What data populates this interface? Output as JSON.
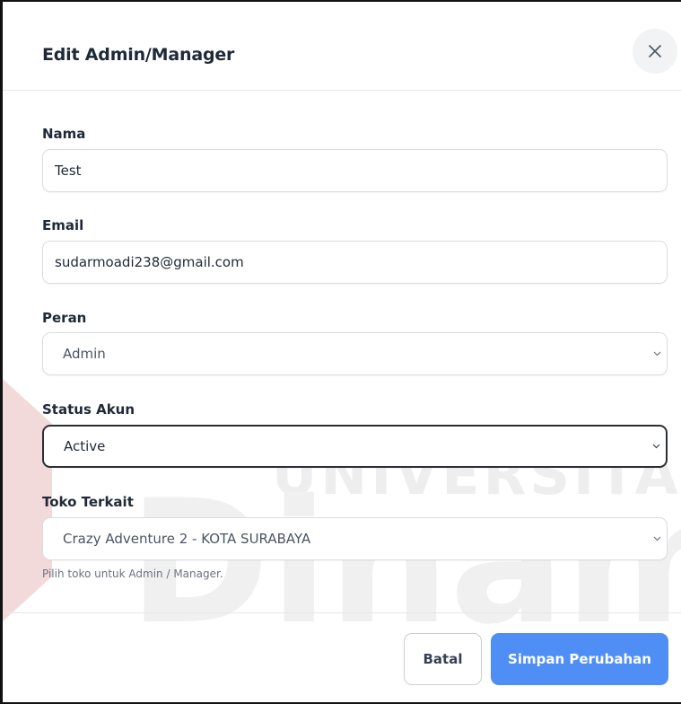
{
  "modal": {
    "title": "Edit Admin/Manager",
    "close_icon": "close-icon"
  },
  "fields": {
    "nama": {
      "label": "Nama",
      "value": "Test"
    },
    "email": {
      "label": "Email",
      "value": "sudarmoadi238@gmail.com"
    },
    "peran": {
      "label": "Peran",
      "value": "Admin"
    },
    "status": {
      "label": "Status Akun",
      "value": "Active"
    },
    "toko": {
      "label": "Toko Terkait",
      "value": "Crazy Adventure 2 - KOTA SURABAYA",
      "help": "Pilih toko untuk Admin / Manager."
    }
  },
  "footer": {
    "cancel_label": "Batal",
    "save_label": "Simpan Perubahan"
  },
  "watermark": {
    "line1": "UNIVERSITAS",
    "line2": "Dinamika"
  },
  "colors": {
    "primary": "#4f8ef5",
    "watermark": "#ececec"
  }
}
